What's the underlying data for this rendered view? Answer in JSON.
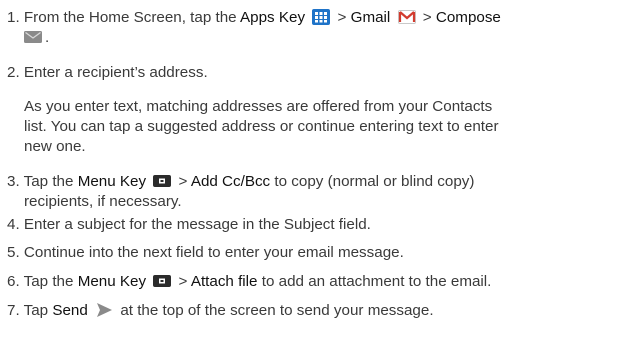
{
  "steps": [
    {
      "n": "1.",
      "t1": "From the Home Screen, tap the",
      "k1": "Apps Key",
      "sep1": ">",
      "k2": "Gmail",
      "sep2": ">",
      "k3": "Compose",
      "end": "."
    },
    {
      "n": "2.",
      "text": "Enter a recipient’s address."
    },
    {
      "n": "3.",
      "t1": "Tap the",
      "k1": "Menu Key",
      "sep1": ">",
      "k2": "Add Cc/Bcc",
      "t2": "to copy (normal or blind copy)",
      "t3": "recipients, if necessary."
    },
    {
      "n": "4.",
      "text": "Enter a subject for the message in the Subject field."
    },
    {
      "n": "5.",
      "text": "Continue into the next field to enter your email message."
    },
    {
      "n": "6.",
      "t1": "Tap the",
      "k1": "Menu Key",
      "sep1": ">",
      "k2": "Attach file",
      "t2": "to add an attachment to the email."
    },
    {
      "n": "7.",
      "t1": "Tap",
      "k1": "Send",
      "t2": "at the top of the screen to send your message."
    }
  ],
  "note": {
    "l1": "As you enter text, matching addresses are offered from your Contacts",
    "l2": "list. You can tap a suggested address or continue entering text to enter",
    "l3": "new one."
  },
  "icons": {
    "apps": "apps-key-icon",
    "gmail": "gmail-icon",
    "compose": "compose-icon",
    "menu": "menu-key-icon",
    "send": "send-icon"
  },
  "colors": {
    "text": "#3a3a3a",
    "emphasis": "#111111",
    "apps_key": "#1e73c8",
    "gmail_red": "#d23b2e",
    "icon_gray": "#8a8a8a",
    "menu_key": "#2b2b2b"
  }
}
